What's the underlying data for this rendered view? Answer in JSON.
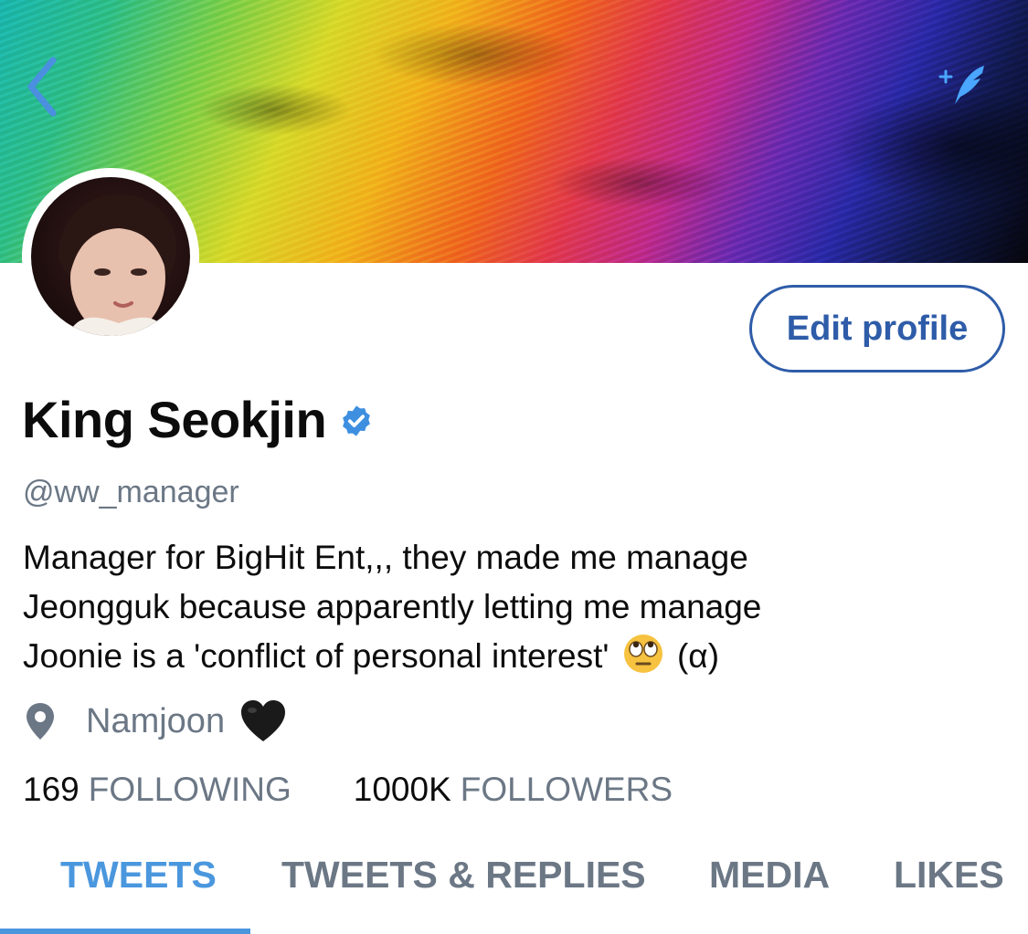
{
  "header": {
    "back_icon": "chevron-left-icon",
    "compose_icon": "sparkle-feather-icon"
  },
  "profile": {
    "avatar": "avatar",
    "edit_button_label": "Edit profile",
    "name": "King Seokjin",
    "verified_icon": "verified-badge-icon",
    "handle": "@ww_manager",
    "bio": {
      "line1": "Manager for BigHit Ent,,, they made me manage",
      "line2": "Jeongguk because apparently letting me manage",
      "line3_prefix": "Joonie is a 'conflict of personal interest'",
      "line3_emoji": "face-with-rolling-eyes-emoji",
      "line3_suffix": "(α)"
    },
    "location": {
      "icon": "location-pin-icon",
      "text": "Namjoon",
      "emoji": "black-heart-icon"
    }
  },
  "stats": {
    "following_count": "169",
    "following_label": "FOLLOWING",
    "followers_count": "1000K",
    "followers_label": "FOLLOWERS"
  },
  "tabs": [
    {
      "label": "TWEETS",
      "active": true
    },
    {
      "label": "TWEETS & REPLIES",
      "active": false
    },
    {
      "label": "MEDIA",
      "active": false
    },
    {
      "label": "LIKES",
      "active": false
    }
  ],
  "colors": {
    "accent": "#4a97de",
    "button_border": "#2e5ca8",
    "secondary_text": "#6b7785",
    "primary_text": "#0c0c0c"
  }
}
